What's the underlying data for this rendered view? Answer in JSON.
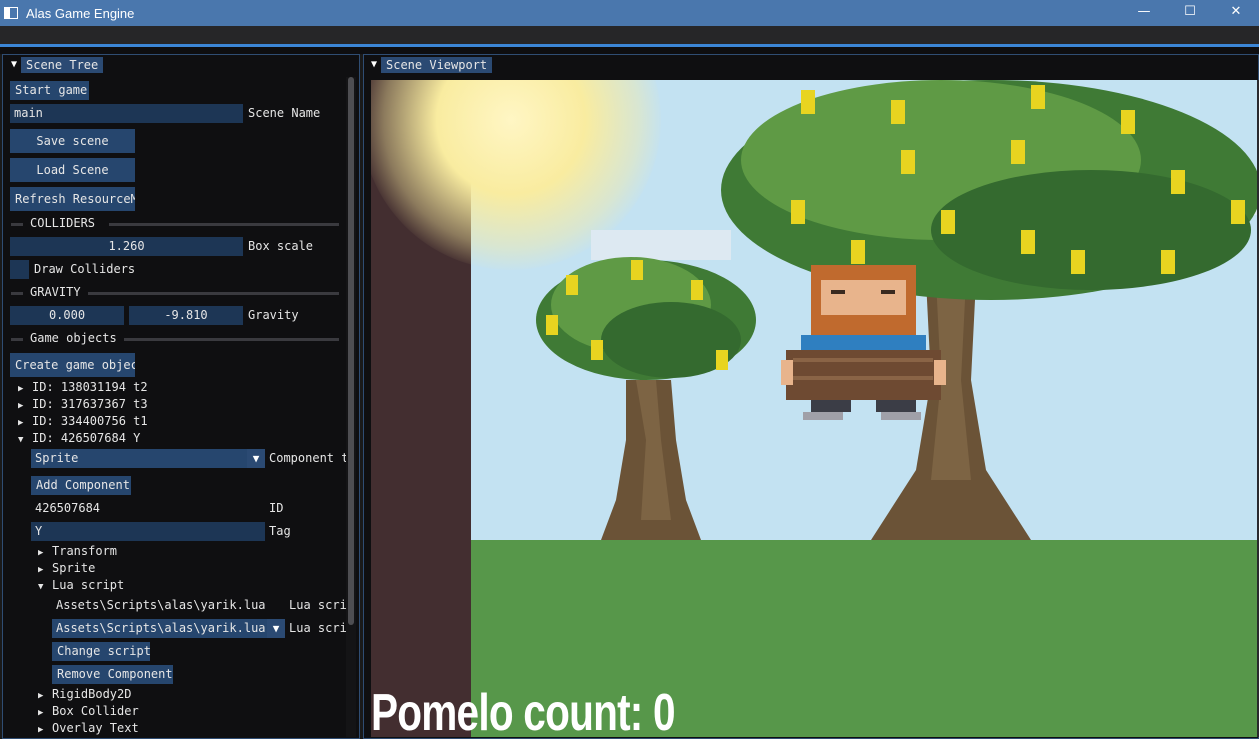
{
  "window": {
    "title": "Alas Game Engine",
    "minimize": "—",
    "maximize": "☐",
    "close": "✕"
  },
  "scene_tree": {
    "tab_label": "Scene Tree",
    "start_game": "Start game",
    "scene_name_value": "main",
    "scene_name_label": "Scene Name",
    "save_scene": "Save scene",
    "load_scene": "Load Scene",
    "refresh": "Refresh ResourceMa",
    "colliders_header": "COLLIDERS",
    "box_scale_value": "1.260",
    "box_scale_label": "Box scale",
    "draw_colliders": "Draw Colliders",
    "gravity_header": "GRAVITY",
    "gravity_x": "0.000",
    "gravity_y": "-9.810",
    "gravity_label": "Gravity",
    "game_objects_header": "Game objects",
    "create_object": "Create game objec",
    "objects": [
      {
        "label": "ID: 138031194 t2"
      },
      {
        "label": "ID: 317637367 t3"
      },
      {
        "label": "ID: 334400756 t1"
      },
      {
        "label": "ID: 426507684 Y"
      }
    ],
    "selected": {
      "component_type_value": "Sprite",
      "component_type_label": "Component t",
      "add_component": "Add Component",
      "id_value": "426507684",
      "id_label": "ID",
      "tag_value": "Y",
      "tag_label": "Tag",
      "components": [
        "Transform",
        "Sprite",
        "Lua script"
      ],
      "lua_script_path": "Assets\\Scripts\\alas\\yarik.lua",
      "lua_script_label": "Lua scri",
      "lua_script_select": "Assets\\Scripts\\alas\\yarik.lua",
      "lua_script_select_label": "Lua scri",
      "change_script": "Change script",
      "remove_component": "Remove Component",
      "more_components": [
        "RigidBody2D",
        "Box Collider",
        "Overlay Text"
      ]
    }
  },
  "viewport": {
    "tab_label": "Scene Viewport",
    "score_text": "Pomelo count: 0"
  },
  "colors": {
    "title_bar": "#4a77ad",
    "accent": "#3c86d6",
    "button": "#26466e",
    "field": "#1d3655",
    "sky": "#c3e2f2",
    "ground": "#57974a"
  }
}
